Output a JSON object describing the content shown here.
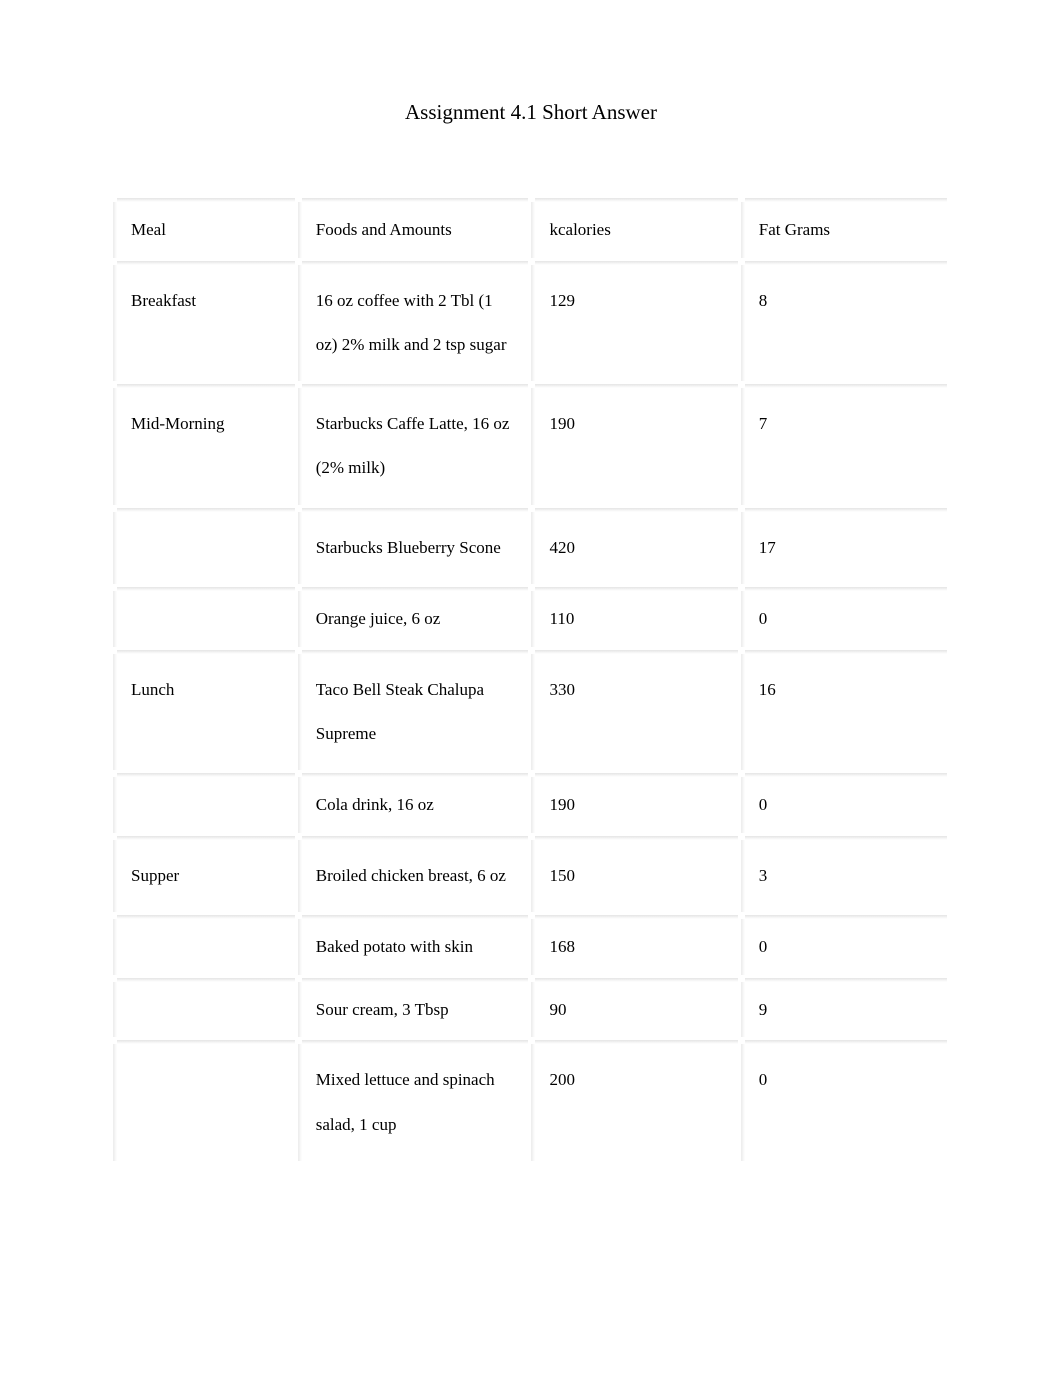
{
  "title": "Assignment 4.1 Short Answer",
  "headers": {
    "meal": "Meal",
    "food": "Foods and Amounts",
    "kcal": "kcalories",
    "fat": "Fat Grams"
  },
  "rows": [
    {
      "meal": "Breakfast",
      "food": "16 oz coffee with 2 Tbl (1 oz) 2% milk and 2 tsp sugar",
      "kcal": "129",
      "fat": "8"
    },
    {
      "meal": "Mid-Morning",
      "food": "Starbucks Caffe Latte, 16 oz (2% milk)",
      "kcal": "190",
      "fat": "7"
    },
    {
      "meal": "",
      "food": "Starbucks Blueberry Scone",
      "kcal": "420",
      "fat": "17"
    },
    {
      "meal": "",
      "food": "Orange juice, 6 oz",
      "kcal": "110",
      "fat": "0"
    },
    {
      "meal": "Lunch",
      "food": "Taco Bell Steak Chalupa Supreme",
      "kcal": "330",
      "fat": "16"
    },
    {
      "meal": "",
      "food": "Cola drink, 16 oz",
      "kcal": "190",
      "fat": "0"
    },
    {
      "meal": "Supper",
      "food": "Broiled chicken breast, 6 oz",
      "kcal": "150",
      "fat": "3"
    },
    {
      "meal": "",
      "food": "Baked potato with skin",
      "kcal": "168",
      "fat": "0"
    },
    {
      "meal": "",
      "food": "Sour cream, 3 Tbsp",
      "kcal": "90",
      "fat": "9"
    },
    {
      "meal": "",
      "food": "Mixed lettuce and spinach salad, 1 cup",
      "kcal": "200",
      "fat": "0"
    }
  ],
  "chart_data": {
    "type": "table",
    "title": "Assignment 4.1 Short Answer",
    "columns": [
      "Meal",
      "Foods and Amounts",
      "kcalories",
      "Fat Grams"
    ],
    "rows": [
      [
        "Breakfast",
        "16 oz coffee with 2 Tbl (1 oz) 2% milk and 2 tsp sugar",
        129,
        8
      ],
      [
        "Mid-Morning",
        "Starbucks Caffe Latte, 16 oz (2% milk)",
        190,
        7
      ],
      [
        "",
        "Starbucks Blueberry Scone",
        420,
        17
      ],
      [
        "",
        "Orange juice, 6 oz",
        110,
        0
      ],
      [
        "Lunch",
        "Taco Bell Steak Chalupa Supreme",
        330,
        16
      ],
      [
        "",
        "Cola drink, 16 oz",
        190,
        0
      ],
      [
        "Supper",
        "Broiled chicken breast, 6 oz",
        150,
        3
      ],
      [
        "",
        "Baked potato with skin",
        168,
        0
      ],
      [
        "",
        "Sour cream, 3 Tbsp",
        90,
        9
      ],
      [
        "",
        "Mixed lettuce and spinach salad, 1 cup",
        200,
        0
      ]
    ]
  }
}
